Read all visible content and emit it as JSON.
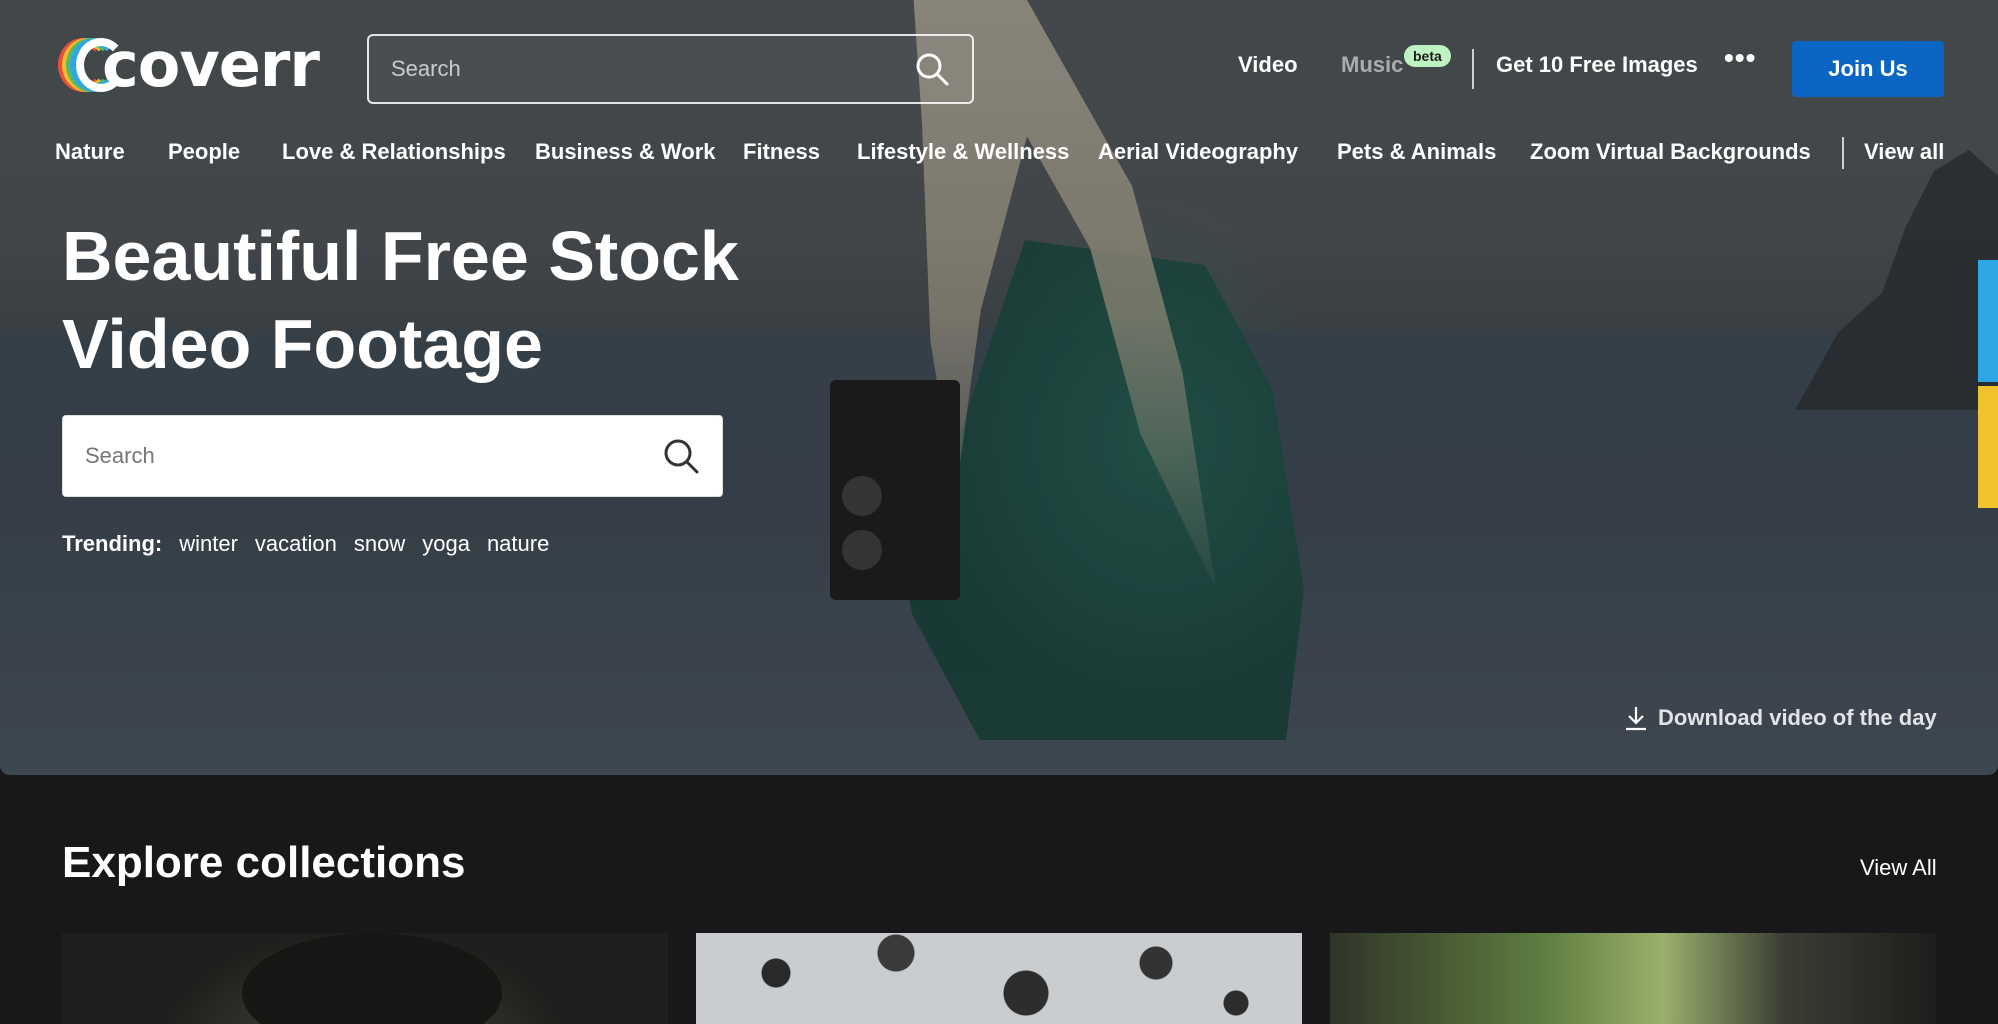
{
  "brand": {
    "name": "coverr",
    "logo_colors": [
      "#e94e3c",
      "#f5b82e",
      "#5cb85c",
      "#2fa7e6"
    ]
  },
  "header": {
    "search_placeholder": "Search",
    "nav": {
      "video": "Video",
      "music": "Music",
      "music_badge": "beta",
      "free_images": "Get 10 Free Images",
      "more": "•••",
      "join": "Join Us"
    }
  },
  "categories": {
    "items": [
      "Nature",
      "People",
      "Love & Relationships",
      "Business & Work",
      "Fitness",
      "Lifestyle & Wellness",
      "Aerial Videography",
      "Pets & Animals",
      "Zoom Virtual Backgrounds"
    ],
    "view_all": "View all"
  },
  "hero": {
    "headline_line1": "Beautiful Free Stock",
    "headline_line2": "Video Footage",
    "search_placeholder": "Search",
    "trending_label": "Trending:",
    "trending": [
      "winter",
      "vacation",
      "snow",
      "yoga",
      "nature"
    ],
    "download": "Download video of the day"
  },
  "explore": {
    "title": "Explore collections",
    "view_all": "View All"
  },
  "colors": {
    "accent": "#0a66c2",
    "background": "#18181b",
    "side_blue": "#2fa7e6",
    "side_yellow": "#f2c12e",
    "beta_badge": "#bff2c2"
  }
}
